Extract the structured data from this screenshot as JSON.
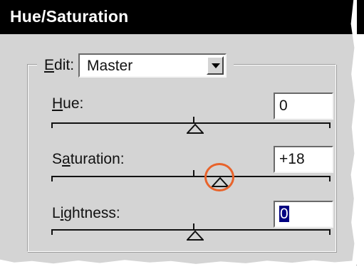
{
  "window": {
    "title": "Hue/Saturation"
  },
  "edit": {
    "label_prefix": "",
    "label_mnemonic": "E",
    "label_rest": "dit:",
    "value": "Master"
  },
  "sliders": [
    {
      "label_prefix": "",
      "mnemonic": "H",
      "label_rest": "ue:",
      "value": "0",
      "position": 0.52
    },
    {
      "label_prefix": "S",
      "mnemonic": "a",
      "label_rest": "turation:",
      "value": "+18",
      "position": 0.61
    },
    {
      "label_prefix": "L",
      "mnemonic": "i",
      "label_rest": "ghtness:",
      "value": "0",
      "position": 0.5
    }
  ],
  "colors": {
    "titlebar": "#000000",
    "dialog_bg": "#d4d4d4",
    "highlight_circle": "#e8632b",
    "selection": "#000080"
  },
  "icons": {
    "dropdown": "chevron-down-icon",
    "slider_thumb": "triangle-up-icon"
  }
}
